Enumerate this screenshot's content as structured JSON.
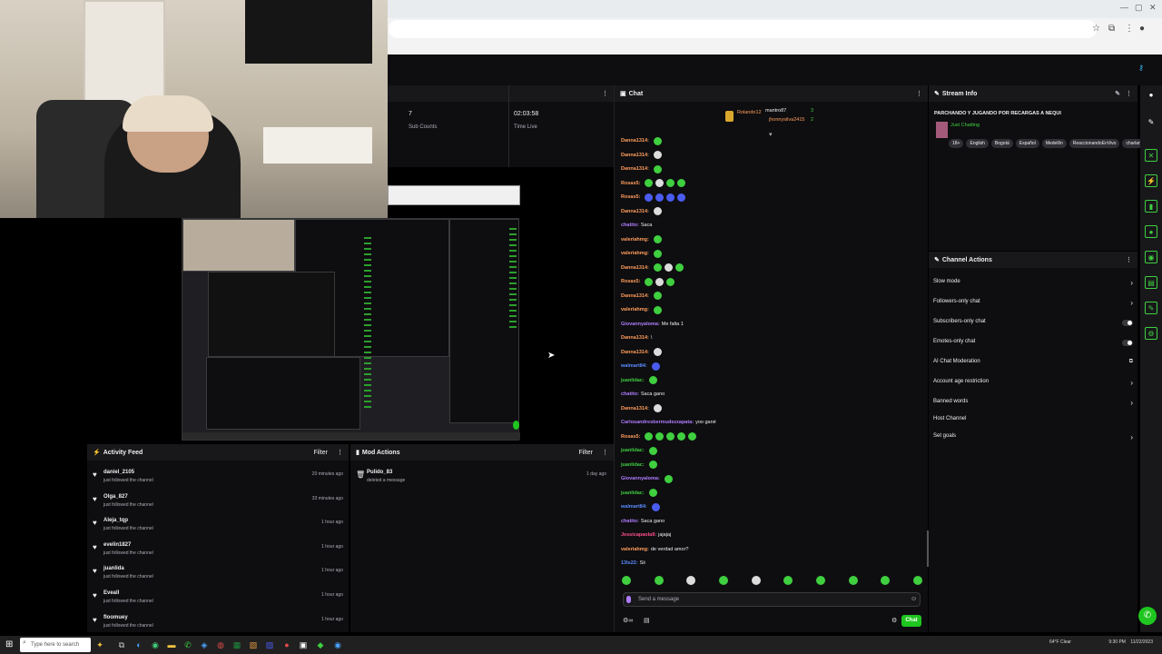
{
  "browser": {
    "win_min": "—",
    "win_max": "▢",
    "win_close": "✕"
  },
  "stats": [
    {
      "value": "7",
      "label": "Sub Counts"
    },
    {
      "value": "02:03:58",
      "label": "Time Live"
    }
  ],
  "activity_feed": {
    "title": "Activity Feed",
    "filter": "Filter",
    "items": [
      {
        "name": "daniel_2105",
        "action": "just followed the channel",
        "time": "20 minutes ago"
      },
      {
        "name": "Olga_827",
        "action": "just followed the channel",
        "time": "33 minutes ago"
      },
      {
        "name": "Aleja_tqp",
        "action": "just followed the channel",
        "time": "1 hour ago"
      },
      {
        "name": "evelin1827",
        "action": "just followed the channel",
        "time": "1 hour ago"
      },
      {
        "name": "juanlida",
        "action": "just followed the channel",
        "time": "1 hour ago"
      },
      {
        "name": "Eveall",
        "action": "just followed the channel",
        "time": "1 hour ago"
      },
      {
        "name": "floomuey",
        "action": "just followed the channel",
        "time": "1 hour ago"
      }
    ]
  },
  "mod_actions": {
    "title": "Mod Actions",
    "filter": "Filter",
    "items": [
      {
        "name": "Pulido_83",
        "action": "deleted a message",
        "time": "1 day ago"
      }
    ]
  },
  "chat": {
    "title": "Chat",
    "pinned": [
      {
        "name": "Rolando12",
        "count": ""
      },
      {
        "name": "mantro87",
        "count": "3"
      },
      {
        "name": "jhonnysilva2415",
        "count": "2"
      }
    ],
    "messages": [
      {
        "user": "Danna1314:",
        "color": "#ff9d5c",
        "text": "",
        "emotes": "g"
      },
      {
        "user": "Danna1314:",
        "color": "#ff9d5c",
        "text": "",
        "emotes": "w"
      },
      {
        "user": "Danna1314:",
        "color": "#ff9d5c",
        "text": "",
        "emotes": "g"
      },
      {
        "user": "Rosas5:",
        "color": "#ff9d5c",
        "text": "",
        "emotes": "gwgg"
      },
      {
        "user": "Rosas5:",
        "color": "#ff9d5c",
        "text": "",
        "emotes": "bbbb"
      },
      {
        "user": "Danna1314:",
        "color": "#ff9d5c",
        "text": "",
        "emotes": "w"
      },
      {
        "user": "chatito:",
        "color": "#b07cff",
        "text": "Saca",
        "emotes": ""
      },
      {
        "user": "valeriahmg:",
        "color": "#ff9d5c",
        "text": "",
        "emotes": "g"
      },
      {
        "user": "valeriahmg:",
        "color": "#ff9d5c",
        "text": "",
        "emotes": "g"
      },
      {
        "user": "Danna1314:",
        "color": "#ff9d5c",
        "text": "",
        "emotes": "gwg"
      },
      {
        "user": "Rosas5:",
        "color": "#ff9d5c",
        "text": "",
        "emotes": "gwg"
      },
      {
        "user": "Danna1314:",
        "color": "#ff9d5c",
        "text": "",
        "emotes": "g"
      },
      {
        "user": "valeriahmg:",
        "color": "#ff9d5c",
        "text": "",
        "emotes": "g"
      },
      {
        "user": "Giovannyaloma:",
        "color": "#b07cff",
        "text": "Me falta 1",
        "emotes": ""
      },
      {
        "user": "Danna1314:",
        "color": "#ff9d5c",
        "text": "\\",
        "emotes": ""
      },
      {
        "user": "Danna1314:",
        "color": "#ff9d5c",
        "text": "",
        "emotes": "w"
      },
      {
        "user": "walmart84:",
        "color": "#5c8cff",
        "text": "",
        "emotes": "b"
      },
      {
        "user": "juanlidac:",
        "color": "#3fcf3f",
        "text": "",
        "emotes": "g"
      },
      {
        "user": "chatito:",
        "color": "#b07cff",
        "text": "Saca gano",
        "emotes": ""
      },
      {
        "user": "Danna1314:",
        "color": "#ff9d5c",
        "text": "",
        "emotes": "w"
      },
      {
        "user": "Carlosandresbermudezzapata:",
        "color": "#b07cff",
        "text": "yoo gané",
        "emotes": ""
      },
      {
        "user": "Rosas5:",
        "color": "#ff9d5c",
        "text": "",
        "emotes": "ggggg"
      },
      {
        "user": "juanlidac:",
        "color": "#3fcf3f",
        "text": "",
        "emotes": "g"
      },
      {
        "user": "juanlidac:",
        "color": "#3fcf3f",
        "text": "",
        "emotes": "g"
      },
      {
        "user": "Giovannyaloma:",
        "color": "#b07cff",
        "text": "",
        "emotes": "g"
      },
      {
        "user": "juanlidac:",
        "color": "#3fcf3f",
        "text": "",
        "emotes": "g"
      },
      {
        "user": "walmart84:",
        "color": "#5c8cff",
        "text": "",
        "emotes": "b"
      },
      {
        "user": "chatito:",
        "color": "#b07cff",
        "text": "Saca gano",
        "emotes": ""
      },
      {
        "user": "Jessicapaola9:",
        "color": "#ff4f8b",
        "text": "jajajaj",
        "emotes": ""
      },
      {
        "user": "valeriahmg:",
        "color": "#ff9d5c",
        "text": "de verdad amor?",
        "emotes": ""
      },
      {
        "user": "13ls22:",
        "color": "#5c8cff",
        "text": "Sii",
        "emotes": ""
      }
    ],
    "input_placeholder": "Send a message",
    "send_label": "Chat",
    "colors": {
      "accent": "#1fc61f"
    }
  },
  "stream_info": {
    "title": "Stream Info",
    "stream_title": "PARCHANDO Y JUGANDO POR RECARGAS A NEQUI",
    "category": "Just Chatting",
    "tags": [
      "18+",
      "English",
      "Bogotá",
      "Español",
      "Medellín",
      "ReaccionandoEnVivo",
      "charlamos"
    ]
  },
  "channel_actions": {
    "title": "Channel Actions",
    "items": [
      {
        "label": "Slow mode",
        "control": "arrow"
      },
      {
        "label": "Followers-only chat",
        "control": "arrow"
      },
      {
        "label": "Subscribers-only chat",
        "control": "toggle"
      },
      {
        "label": "Emotes-only chat",
        "control": "toggle"
      },
      {
        "label": "AI Chat Moderation",
        "control": "link"
      },
      {
        "label": "Account age restriction",
        "control": "arrow"
      },
      {
        "label": "Banned words",
        "control": "arrow"
      },
      {
        "label": "Host Channel",
        "control": "none"
      },
      {
        "label": "Set goals",
        "control": "arrow"
      }
    ]
  },
  "taskbar": {
    "search_placeholder": "Type here to search",
    "weather": "64°F Clear",
    "time": "9:30 PM",
    "date": "11/22/2023"
  }
}
